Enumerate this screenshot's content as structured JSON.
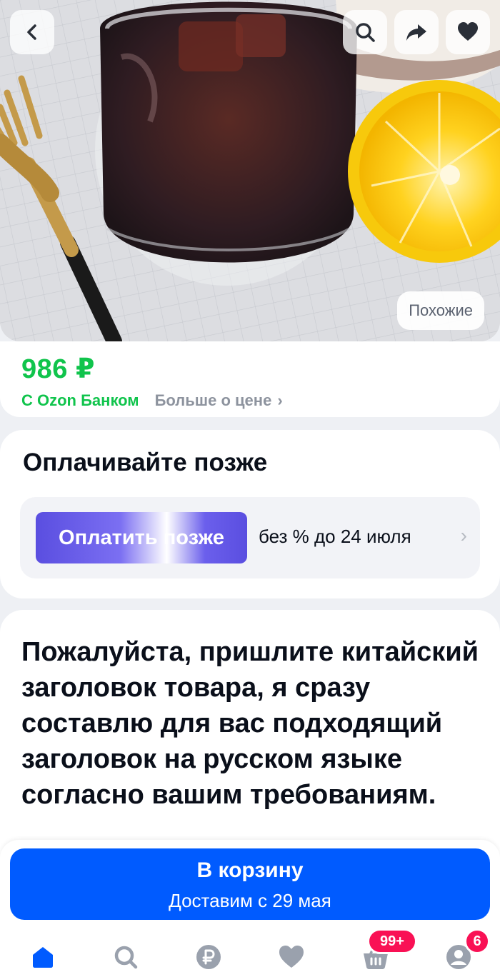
{
  "hero": {
    "back_icon": "chevron-left-icon",
    "search_icon": "search-icon",
    "share_icon": "share-arrow-icon",
    "favorite_icon": "heart-icon",
    "similar_label": "Похожие"
  },
  "price": {
    "value": "986 ₽",
    "bank_label": "С Ozon Банком",
    "more_label": "Больше о цене",
    "more_arrow": "›",
    "accent_color": "#10c44c"
  },
  "paylater": {
    "title": "Оплачивайте позже",
    "button_label": "Оплатить позже",
    "terms": "без % до 24 июля",
    "chevron": "›"
  },
  "product": {
    "title": "Пожалуйста, пришлите китайский заголовок товара, я сразу составлю для вас подходящий заголовок на русском языке согласно вашим требованиям."
  },
  "cart": {
    "label": "В корзину",
    "delivery": "Доставим с 29 мая",
    "color": "#005bff"
  },
  "nav": {
    "items": [
      {
        "icon": "home-icon",
        "active": true
      },
      {
        "icon": "search-icon"
      },
      {
        "icon": "ruble-icon"
      },
      {
        "icon": "heart-icon"
      },
      {
        "icon": "basket-icon",
        "badge": "99+"
      },
      {
        "icon": "profile-icon",
        "badge": "6"
      }
    ],
    "badge_color": "#f91155"
  }
}
